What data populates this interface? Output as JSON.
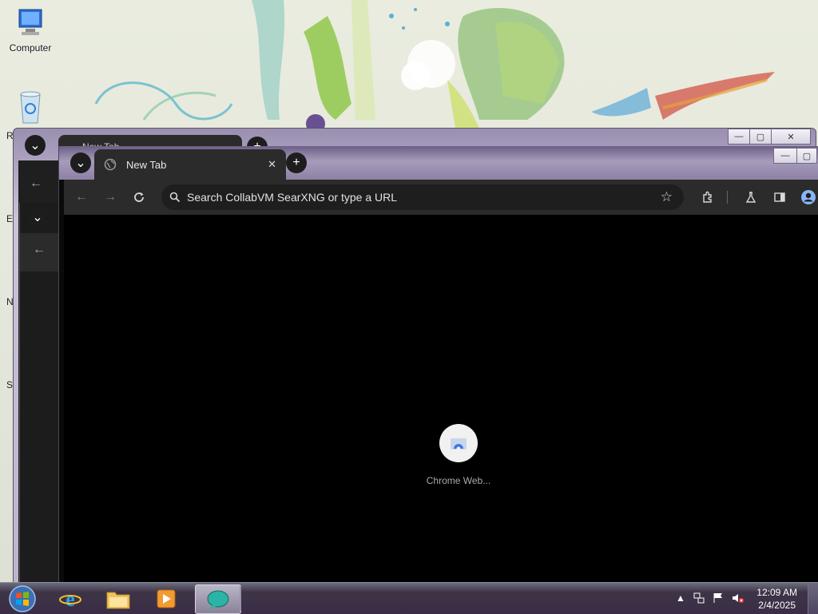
{
  "desktop": {
    "icons": [
      {
        "name": "computer",
        "label": "Computer"
      },
      {
        "name": "recycle-bin",
        "label": ""
      }
    ],
    "edge_letters": [
      "R",
      "E",
      "N",
      "S"
    ]
  },
  "back_window": {
    "tab_title": "New Tab"
  },
  "browser": {
    "tab_title": "New Tab",
    "tab_close": "✕",
    "new_tab": "+",
    "omnibox_placeholder": "Search CollabVM SearXNG or type a URL",
    "shortcut_label": "Chrome Web..."
  },
  "taskbar": {
    "apps": [
      "start",
      "internet-explorer",
      "file-explorer",
      "media-player",
      "chrome-canary"
    ],
    "time": "12:09 AM",
    "date": "2/4/2025"
  },
  "colors": {
    "chrome_dark": "#2b2b2b",
    "frame_purple": "#8d80a6",
    "taskbar": "#3a2d46"
  }
}
